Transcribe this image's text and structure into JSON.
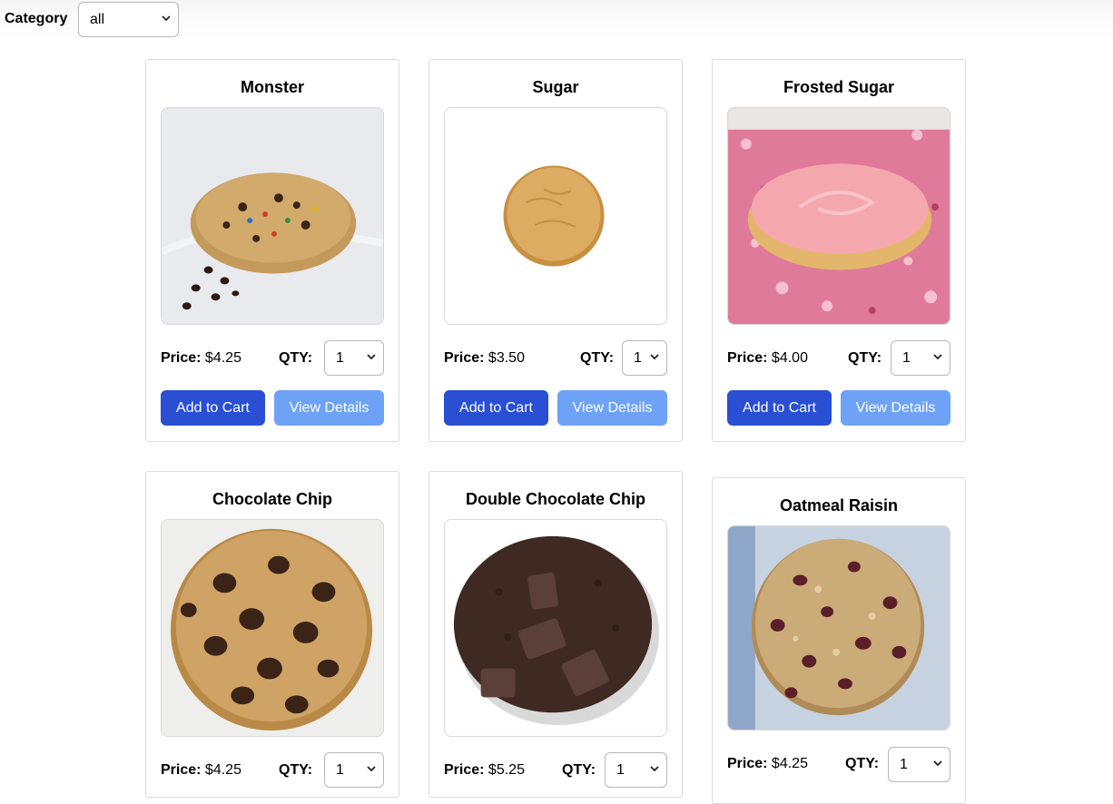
{
  "filter": {
    "label": "Category",
    "selected": "all"
  },
  "labels": {
    "price": "Price:",
    "qty": "QTY:",
    "add_to_cart": "Add to Cart",
    "view_details": "View Details"
  },
  "products": [
    {
      "name": "Monster",
      "price": "$4.25",
      "qty": "1"
    },
    {
      "name": "Sugar",
      "price": "$3.50",
      "qty": "1"
    },
    {
      "name": "Frosted Sugar",
      "price": "$4.00",
      "qty": "1"
    },
    {
      "name": "Chocolate Chip",
      "price": "$4.25",
      "qty": "1"
    },
    {
      "name": "Double Chocolate Chip",
      "price": "$5.25",
      "qty": "1"
    },
    {
      "name": "Oatmeal Raisin",
      "price": "$4.25",
      "qty": "1"
    }
  ]
}
